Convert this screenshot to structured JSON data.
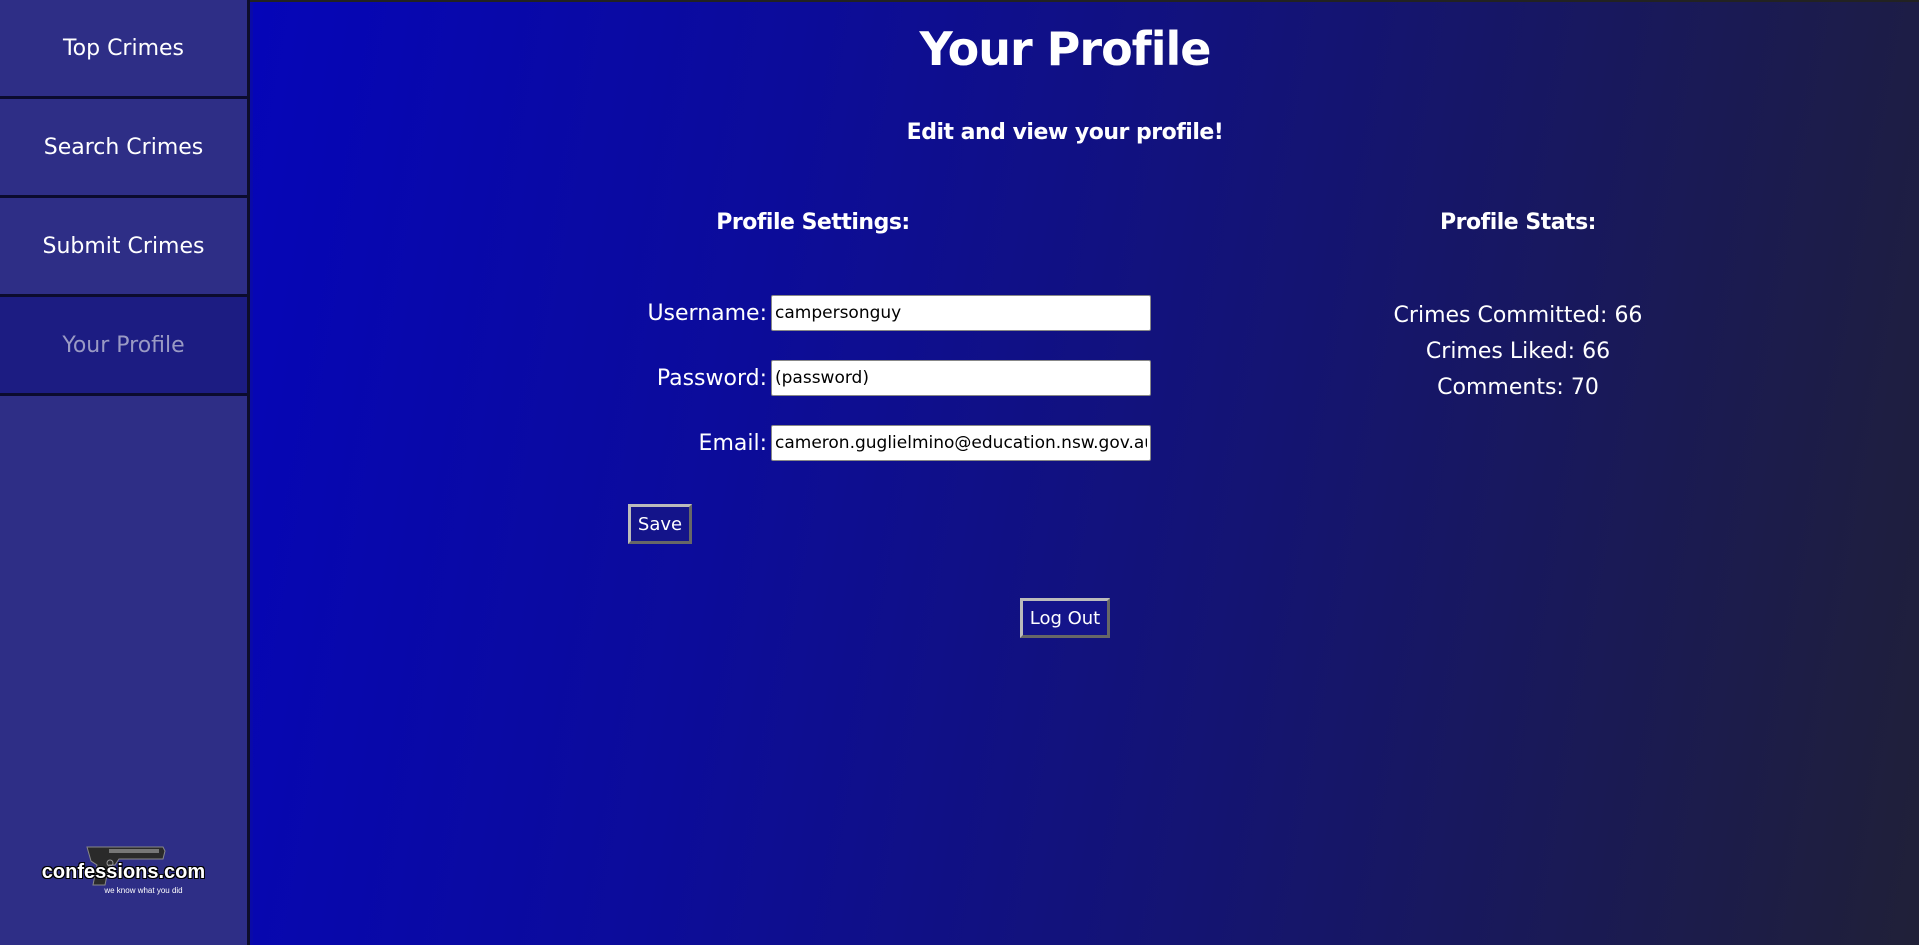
{
  "sidebar": {
    "items": [
      {
        "label": "Top Crimes"
      },
      {
        "label": "Search Crimes"
      },
      {
        "label": "Submit Crimes"
      },
      {
        "label": "Your Profile"
      }
    ],
    "logo": {
      "text": "confessions.com",
      "tagline": "we know what you did"
    }
  },
  "header": {
    "title": "Your Profile",
    "subtitle": "Edit and view your profile!"
  },
  "settings": {
    "heading": "Profile Settings:",
    "username_label": "Username:",
    "username_value": "campersonguy",
    "password_label": "Password:",
    "password_value": "(password)",
    "email_label": "Email:",
    "email_value": "cameron.guglielmino@education.nsw.gov.au",
    "save_label": "Save"
  },
  "stats": {
    "heading": "Profile Stats:",
    "crimes_committed": "Crimes Committed: 66",
    "crimes_liked": "Crimes Liked: 66",
    "comments": "Comments: 70"
  },
  "logout_label": "Log Out",
  "colors": {
    "sidebar_bg": "#2e2e86",
    "active_item_bg": "#1c1c82",
    "button_bg": "#14148a",
    "main_gradient_start": "#0505b8",
    "main_gradient_end": "#202038"
  }
}
